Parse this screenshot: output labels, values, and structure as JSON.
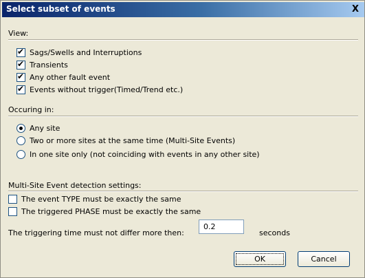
{
  "window": {
    "title": "Select subset of events",
    "close_label": "X"
  },
  "view": {
    "label": "View:",
    "items": [
      {
        "label": "Sags/Swells and Interruptions",
        "checked": true
      },
      {
        "label": "Transients",
        "checked": true
      },
      {
        "label": "Any other fault event",
        "checked": true
      },
      {
        "label": "Events without trigger(Timed/Trend etc.)",
        "checked": true
      }
    ]
  },
  "occurring": {
    "label": "Occuring in:",
    "options": [
      {
        "label": "Any site",
        "selected": true
      },
      {
        "label": "Two or more sites at the same time (Multi-Site Events)",
        "selected": false
      },
      {
        "label": "In one site only (not coinciding with events in any other site)",
        "selected": false
      }
    ]
  },
  "multisite": {
    "label": "Multi-Site Event detection settings:",
    "items": [
      {
        "label": "The event TYPE must be exactly the same",
        "checked": false
      },
      {
        "label": "The triggered PHASE must be exactly the same",
        "checked": false
      }
    ],
    "time_label": "The triggering time must not differ more then:",
    "time_value": "0.2",
    "time_unit": "seconds"
  },
  "buttons": {
    "ok": "OK",
    "cancel": "Cancel"
  }
}
